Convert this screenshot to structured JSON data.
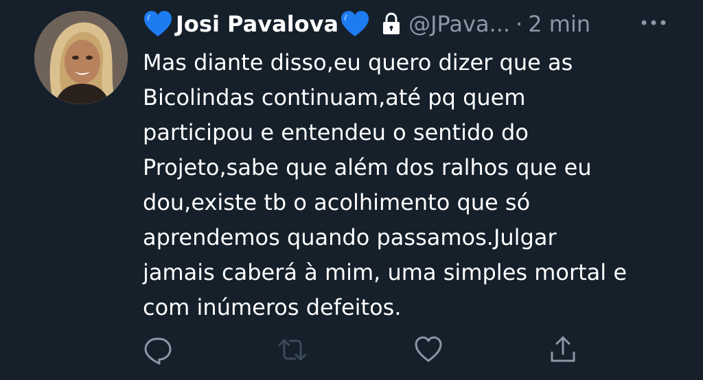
{
  "tweet": {
    "author": {
      "display_name": "Josi Pavalova",
      "handle": "@JPava...",
      "name_emoji_before": "blue-heart-icon",
      "name_emoji_after": "blue-heart-icon",
      "protected_icon": "lock-icon"
    },
    "separator": "·",
    "timestamp": "2 min",
    "text": "Mas diante disso,eu quero dizer que as\nBicolindas continuam,até pq quem\nparticipou e entendeu o sentido do\nProjeto,sabe que além dos ralhos que eu\ndou,existe tb o acolhimento que só\naprendemos quando passamos.Julgar\njamais caberá à mim, uma simples mortal e\ncom inúmeros defeitos.",
    "actions": [
      "reply-icon",
      "retweet-icon",
      "like-icon",
      "share-icon"
    ]
  },
  "colors": {
    "background": "#15202b",
    "text_primary": "#ffffff",
    "text_secondary": "#8b98a5",
    "heart_blue": "#1e7cf2"
  }
}
